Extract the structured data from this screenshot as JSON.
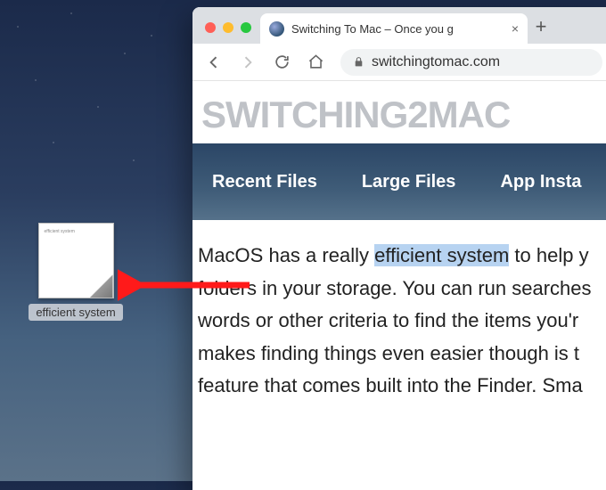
{
  "desktop": {
    "clipping": {
      "tiny_preview": "efficient system",
      "label": "efficient system"
    }
  },
  "browser": {
    "tab_title": "Switching To Mac – Once you g",
    "toolbar": {
      "url_display": "switchingtomac.com"
    },
    "page": {
      "logo_text": "SWITCHING2MAC",
      "nav_items": [
        "Recent Files",
        "Large Files",
        "App Insta"
      ],
      "article": {
        "line1_prefix": "MacOS has a really ",
        "line1_highlight": "efficient system",
        "line1_suffix": " to help y",
        "line2": "folders in your storage. You can run searches",
        "line3": "words or other criteria to find the items you'r",
        "line4": "makes finding things even easier though is t",
        "line5": "feature that comes built into the Finder. Sma"
      }
    }
  }
}
